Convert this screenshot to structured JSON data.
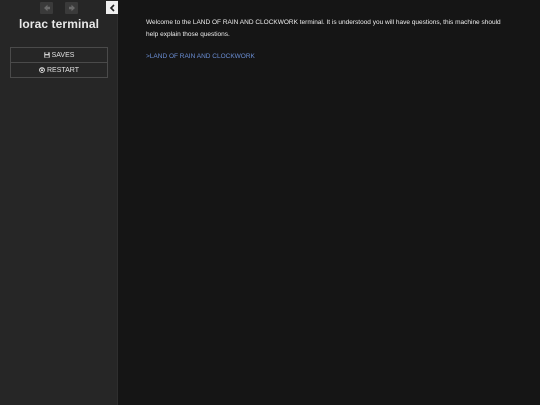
{
  "sidebar": {
    "title": "lorac terminal",
    "nav": {
      "back_icon": "arrow-left-icon",
      "forward_icon": "arrow-right-icon",
      "collapse_icon": "chevron-left-icon"
    },
    "menu": [
      {
        "label": "SAVES",
        "icon": "save-icon"
      },
      {
        "label": "RESTART",
        "icon": "power-icon"
      }
    ]
  },
  "passage": {
    "text": "Welcome to the LAND OF RAIN AND CLOCKWORK terminal. It is understood you will have questions, this machine should help explain those questions.",
    "link_text": ">LAND OF RAIN AND CLOCKWORK"
  },
  "colors": {
    "sidebar_bg": "#262626",
    "main_bg": "#151515",
    "link": "#6b8fd6",
    "text": "#eeeeee"
  }
}
